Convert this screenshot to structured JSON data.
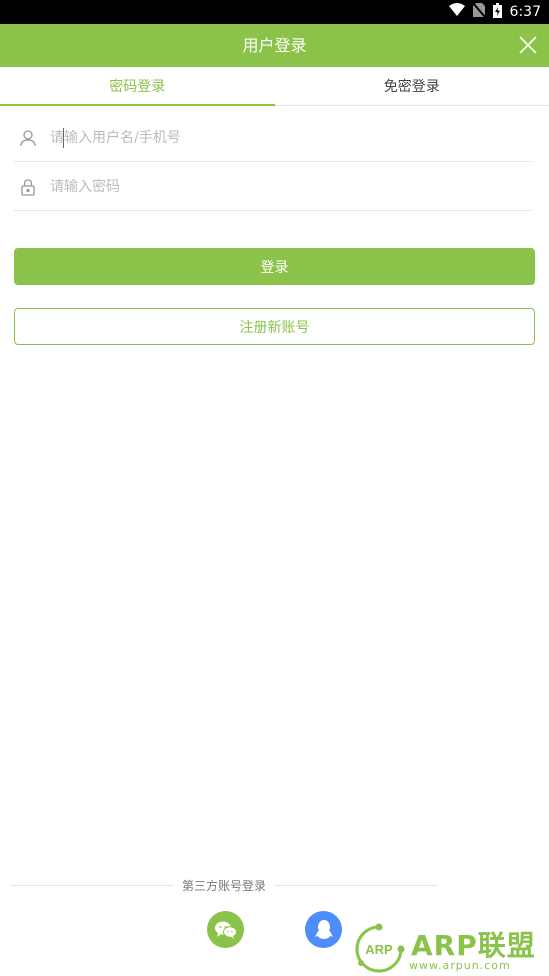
{
  "status_bar": {
    "time": "6:37"
  },
  "header": {
    "title": "用户登录"
  },
  "tabs": [
    {
      "label": "密码登录",
      "active": true
    },
    {
      "label": "免密登录",
      "active": false
    }
  ],
  "form": {
    "username_placeholder": "请输入用户名/手机号",
    "password_placeholder": "请输入密码",
    "login_label": "登录",
    "register_label": "注册新账号"
  },
  "third_party": {
    "label": "第三方账号登录",
    "providers": [
      "wechat",
      "qq"
    ]
  },
  "watermark": {
    "brand": "ARP联盟",
    "url": "www.arpun.com",
    "badge": "ARP"
  },
  "colors": {
    "accent": "#8bc34a",
    "qq": "#4d8dfd"
  }
}
